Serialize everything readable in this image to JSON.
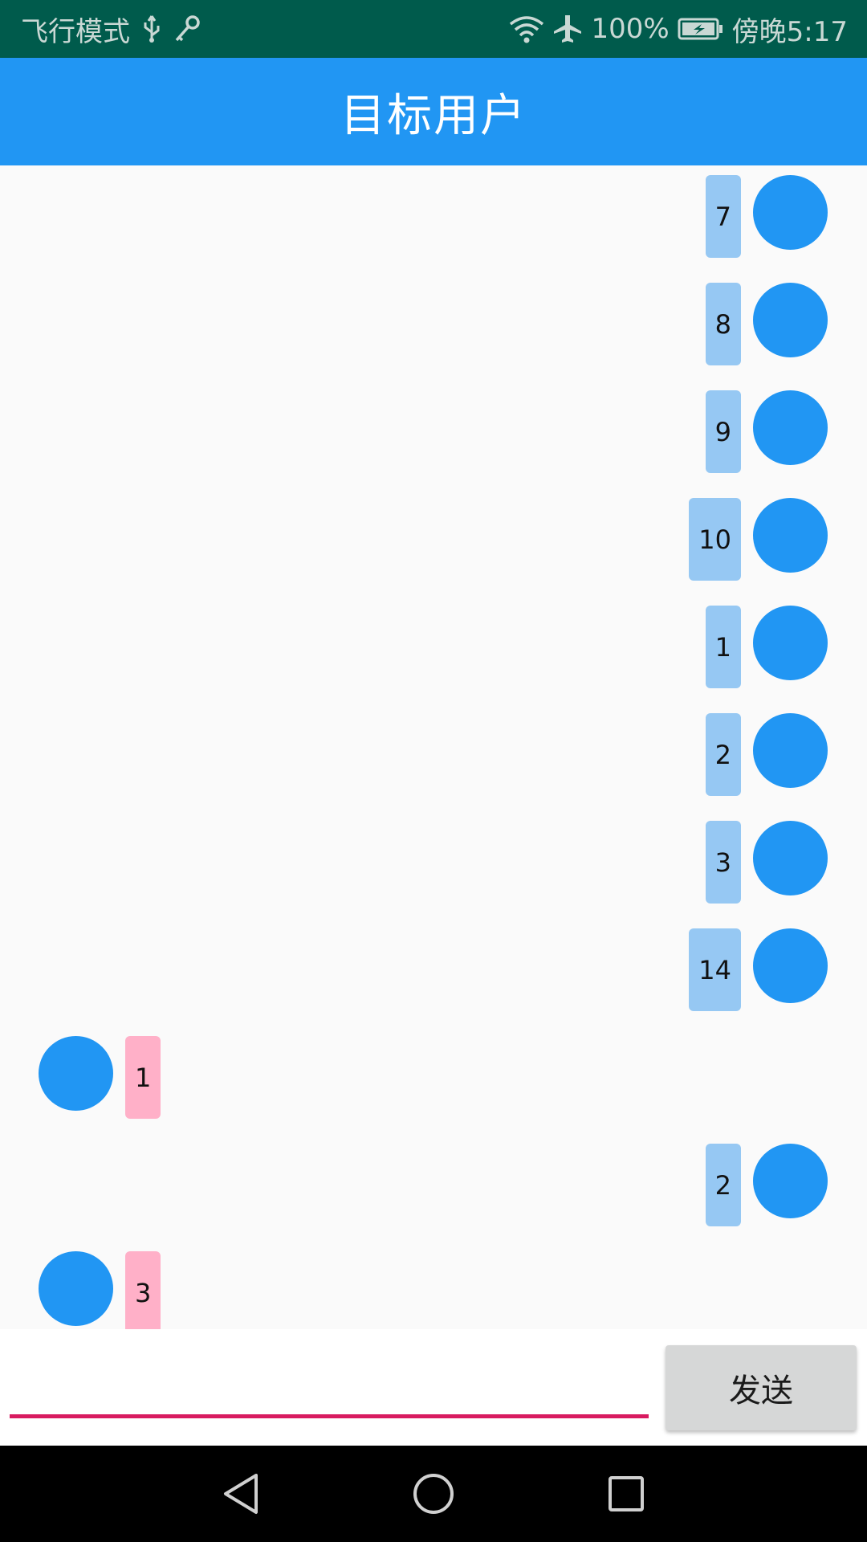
{
  "status_bar": {
    "left_text": "飞行模式",
    "battery": "100%",
    "time": "傍晚5:17",
    "icons": [
      "usb-icon",
      "key-icon",
      "wifi-icon",
      "airplane-icon",
      "battery-charging-icon"
    ]
  },
  "app_bar": {
    "title": "目标用户"
  },
  "messages": [
    {
      "side": "right",
      "text": "7"
    },
    {
      "side": "right",
      "text": "8"
    },
    {
      "side": "right",
      "text": "9"
    },
    {
      "side": "right",
      "text": "10"
    },
    {
      "side": "right",
      "text": "1"
    },
    {
      "side": "right",
      "text": "2"
    },
    {
      "side": "right",
      "text": "3"
    },
    {
      "side": "right",
      "text": "14"
    },
    {
      "side": "left",
      "text": "1"
    },
    {
      "side": "right",
      "text": "2"
    },
    {
      "side": "left",
      "text": "3"
    }
  ],
  "composer": {
    "input_value": "",
    "input_placeholder": "",
    "send_label": "发送"
  },
  "colors": {
    "status_bar": "#005B4C",
    "app_bar": "#2196F3",
    "avatar": "#2196F3",
    "bubble_outgoing": "#96C8F3",
    "bubble_incoming": "#FFB0C8",
    "input_underline": "#D81B60"
  },
  "nav_bar": {
    "icons": [
      "back-icon",
      "home-icon",
      "recents-icon"
    ]
  }
}
